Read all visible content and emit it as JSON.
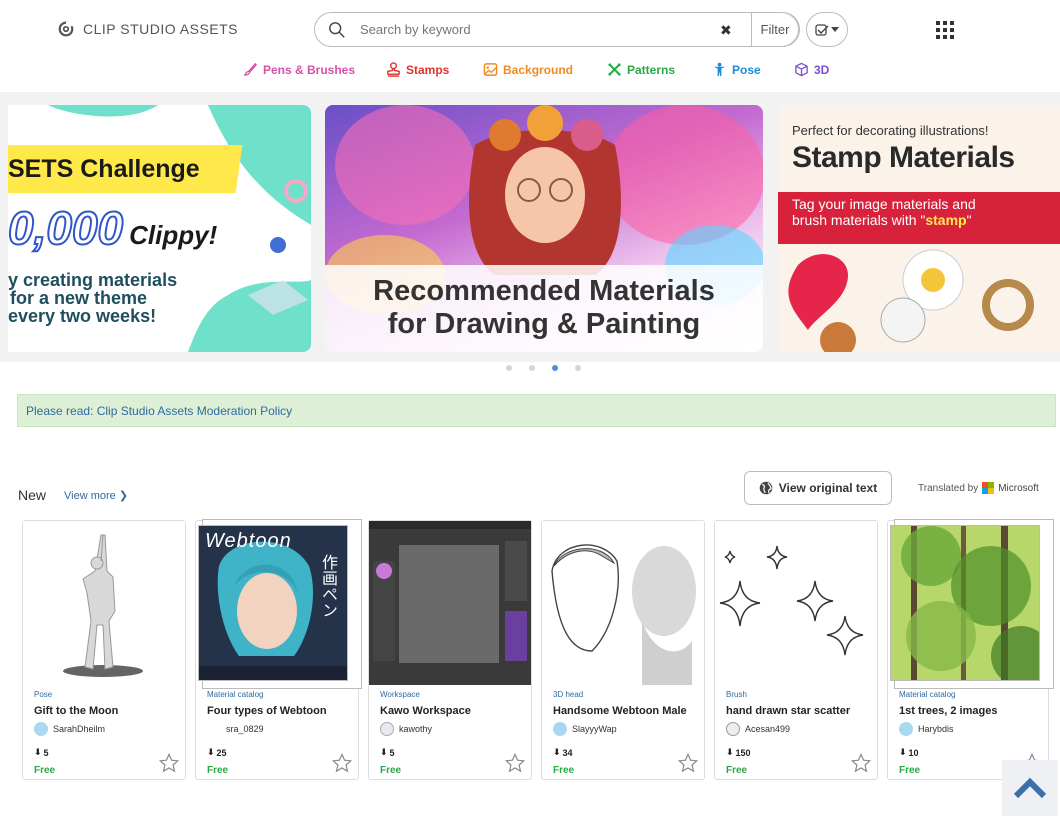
{
  "header": {
    "logo_text": "CLIP STUDIO ASSETS",
    "search_placeholder": "Search by keyword",
    "filter_label": "Filter"
  },
  "categories": [
    {
      "label": "Pens & Brushes",
      "color": "#d94fa8",
      "icon": "brush-icon"
    },
    {
      "label": "Stamps",
      "color": "#e0332f",
      "icon": "stamp-icon"
    },
    {
      "label": "Background",
      "color": "#f08c1e",
      "icon": "image-icon"
    },
    {
      "label": "Patterns",
      "color": "#2aa848",
      "icon": "pattern-icon"
    },
    {
      "label": "Pose",
      "color": "#1c8bd6",
      "icon": "pose-icon"
    },
    {
      "label": "3D",
      "color": "#7b4fd1",
      "icon": "cube-icon"
    }
  ],
  "banners": {
    "slide1": {
      "line1": "SETS Challenge",
      "line2": "0,000",
      "line2b": "Clippy!",
      "line3": "y creating materials",
      "line4": "for a new theme",
      "line5": "every two weeks!"
    },
    "slide2": {
      "line1": "Recommended Materials",
      "line2": "for Drawing & Painting"
    },
    "slide3": {
      "line1": "Perfect for decorating illustrations!",
      "line2": "Stamp Materials",
      "line3": "Tag your image materials and",
      "line4a": "brush materials with \"",
      "line4b": "stamp",
      "line4c": "\""
    }
  },
  "notice": "Please read: Clip Studio Assets Moderation Policy",
  "section": {
    "title": "New",
    "view_more": "View more",
    "view_original": "View original text",
    "translated_by": "Translated by",
    "translator": "Microsoft"
  },
  "cards": [
    {
      "type": "Pose",
      "title": "Gift to the Moon",
      "author": "SarahDheilm",
      "downloads": "5",
      "price": "Free"
    },
    {
      "type": "Material catalog",
      "title": "Four types of Webtoon",
      "author": "sra_0829",
      "downloads": "25",
      "price": "Free",
      "thumb_text": "Webtoon",
      "thumb_text2": "作画ペン"
    },
    {
      "type": "Workspace",
      "title": "Kawo Workspace",
      "author": "kawothy",
      "downloads": "5",
      "price": "Free"
    },
    {
      "type": "3D head",
      "title": "Handsome Webtoon Male",
      "author": "SlayyyWap",
      "downloads": "34",
      "price": "Free"
    },
    {
      "type": "Brush",
      "title": "hand drawn star scatter",
      "author": "Acesan499",
      "downloads": "150",
      "price": "Free"
    },
    {
      "type": "Material catalog",
      "title": "1st trees, 2 images",
      "author": "Harybdis",
      "downloads": "10",
      "price": "Free"
    }
  ]
}
